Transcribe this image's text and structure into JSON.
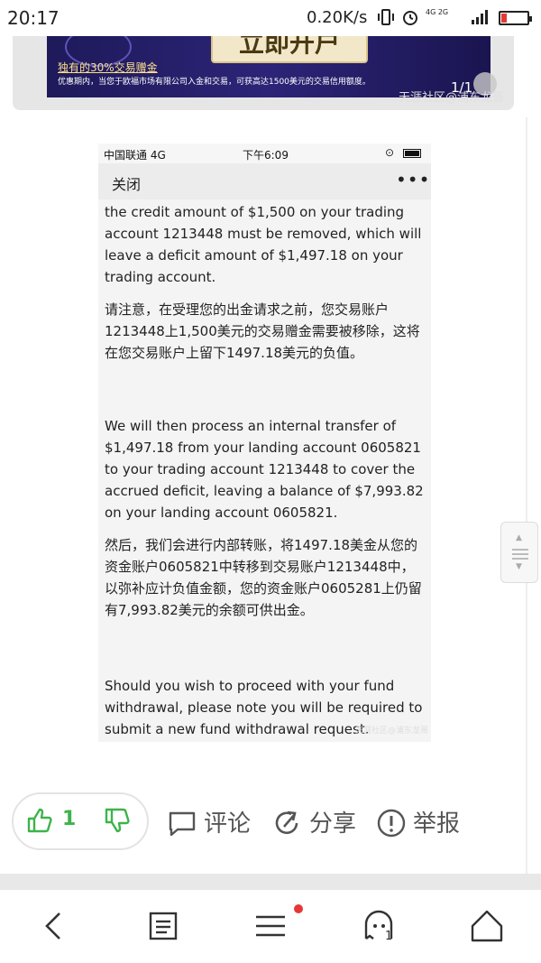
{
  "status_bar": {
    "time": "20:17",
    "speed": "0.20K/s",
    "network_badge": "4G 2G",
    "icons": [
      "vibrate-icon",
      "alarm-icon",
      "signal-icon",
      "battery-low-icon"
    ],
    "battery_level": 0.2
  },
  "banner": {
    "cta": "立即开户",
    "title": "独有的30%交易赠金",
    "desc": "优惠期内，当您于欧福市场有限公司入金和交易，可获高达1500美元的交易信用额度。",
    "page": "1/1",
    "watermark": "天涯社区@浦东龙哥"
  },
  "shot": {
    "status": {
      "carrier": "中国联通  4G",
      "time": "下午6:09"
    },
    "nav": {
      "close": "关闭",
      "more": "•••"
    },
    "paragraphs": [
      "the credit amount of $1,500 on your trading account 1213448 must be removed, which will leave a deficit amount of $1,497.18 on your trading account.",
      "请注意，在受理您的出金请求之前，您交易账户1213448上1,500美元的交易赠金需要被移除，这将在您交易账户上留下1497.18美元的负值。",
      "We will then process an internal transfer of $1,497.18 from your landing account 0605821 to your trading account 1213448 to cover the accrued deficit, leaving a balance of $7,993.82 on your landing account 0605821.",
      "然后，我们会进行内部转账，将1497.18美金从您的资金账户0605821中转移到交易账户1213448中，以弥补应计负值金额，您的资金账户0605281上仍留有7,993.82美元的余额可供出金。",
      "Should you wish to proceed with your fund withdrawal, please note you will be required to submit a new fund withdrawal request."
    ],
    "watermark": "天涯社区@浦东龙哥"
  },
  "actions": {
    "vote_count": "1",
    "comment": "评论",
    "share": "分享",
    "report": "举报"
  },
  "bottom_nav": {
    "items": [
      "back-icon",
      "reader-icon",
      "menu-icon",
      "chat-icon",
      "home-icon"
    ],
    "chat_count": "1"
  },
  "colors": {
    "accent_green": "#3cb44a",
    "badge_red": "#e53935",
    "banner_bg": "#241f6a"
  }
}
